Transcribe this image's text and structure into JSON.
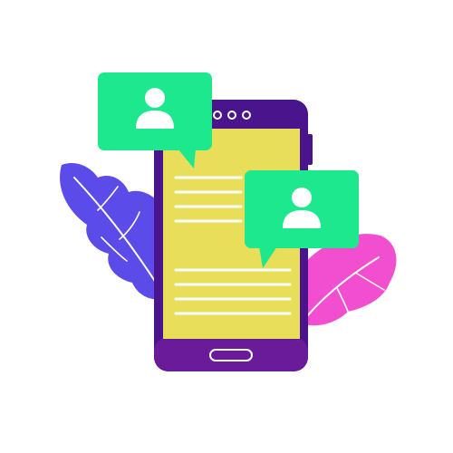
{
  "illustration": {
    "subject": "smartphone-chat",
    "colors": {
      "phone_body": "#4A148C",
      "phone_body_highlight": "#7B1FA2",
      "screen": "#E8DE5A",
      "text_lines": "#FFFFFF",
      "chat_bubble": "#1EE88E",
      "avatar": "#FFFFFF",
      "leaf_left": "#5B4BE8",
      "leaf_right": "#F24FD0",
      "home_button_outline": "#FFFFFF",
      "camera_dots": "#FFFFFF"
    },
    "icons": [
      "user-avatar-icon",
      "user-avatar-icon"
    ]
  }
}
